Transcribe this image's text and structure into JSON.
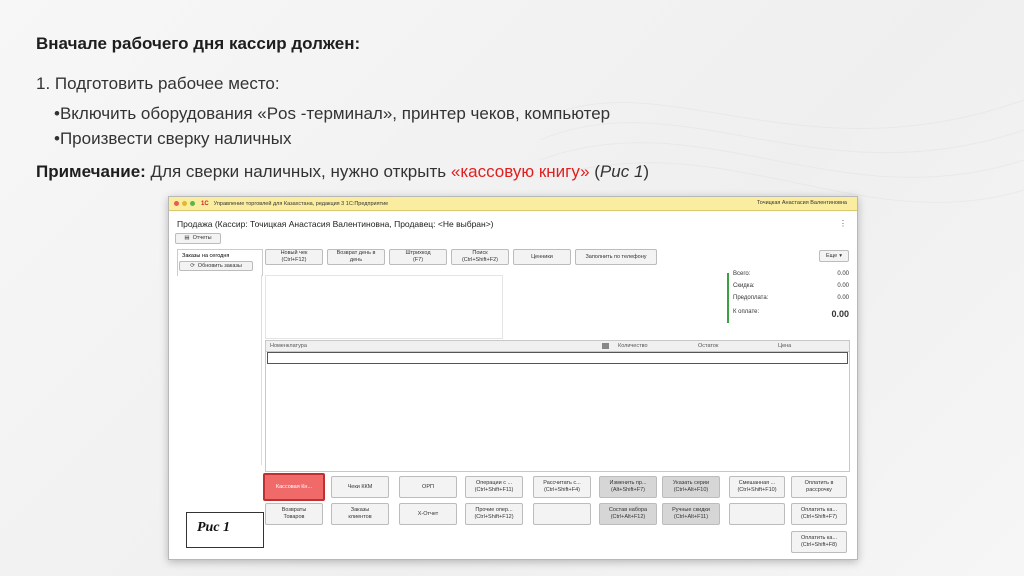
{
  "slide": {
    "title": "Вначале рабочего дня кассир должен:",
    "step1": "1. Подготовить рабочее место:",
    "bullets": [
      "Включить оборудования «Pos -терминал», принтер чеков, компьютер",
      "Произвести сверку наличных"
    ],
    "note_label": "Примечание:",
    "note_text": " Для сверки наличных, нужно открыть ",
    "note_link": "«кассовую книгу»",
    "note_open_paren": " (",
    "note_ref": "Рис 1",
    "note_close_paren": ")"
  },
  "window": {
    "app_title": "Управление торговлей для Казахстана, редакция 3 1С:Предприятие",
    "logo": "1С",
    "user": "Точицкая Анастасия Валентиновна",
    "doc_title": "Продажа (Кассир: Точицкая Анастасия Валентиновна, Продавец: <Не выбран>)",
    "reports_button": "Отчеты",
    "more_button": "Еще",
    "toolbar": [
      {
        "line1": "Новый чек",
        "line2": "(Ctrl+F12)"
      },
      {
        "line1": "Возврат день в",
        "line2": "день"
      },
      {
        "line1": "Штрихкод",
        "line2": "(F7)"
      },
      {
        "line1": "Поиск",
        "line2": "(Ctrl+Shift+F2)"
      },
      {
        "line1": "Ценники",
        "line2": ""
      },
      {
        "line1": "Заполнить по телефону",
        "line2": ""
      }
    ],
    "left_tab": "Заказы на сегодня",
    "refresh_orders": "Обновить заказы",
    "totals": [
      {
        "label": "Всего:",
        "value": "0.00"
      },
      {
        "label": "Скидка:",
        "value": "0.00"
      },
      {
        "label": "Предоплата:",
        "value": "0.00"
      },
      {
        "label": "К оплате:",
        "value": "0.00"
      }
    ],
    "table_headers": [
      "Номенклатура",
      "Количество",
      "Остаток",
      "Цена"
    ],
    "bottom_buttons_row1": [
      {
        "line1": "Кассовая Кн...",
        "line2": ""
      },
      {
        "line1": "Чеки ККМ",
        "line2": ""
      },
      {
        "line1": "ОРП",
        "line2": ""
      },
      {
        "line1": "Операции с ...",
        "line2": "(Ctrl+Shift+F11)"
      },
      {
        "line1": "Рассчитать с...",
        "line2": "(Ctrl+Shift+F4)"
      },
      {
        "line1": "Изменить пр...",
        "line2": "(Alt+Shift+F7)"
      },
      {
        "line1": "Указать серии",
        "line2": "(Ctrl+Alt+F10)"
      },
      {
        "line1": "Смешанная ...",
        "line2": "(Ctrl+Shift+F10)"
      },
      {
        "line1": "Оплатить в",
        "line2": "рассрочку"
      }
    ],
    "bottom_buttons_row2": [
      {
        "line1": "Возвраты",
        "line2": "Товаров"
      },
      {
        "line1": "Заказы",
        "line2": "клиентов"
      },
      {
        "line1": "X-Отчет",
        "line2": ""
      },
      {
        "line1": "Прочие опер...",
        "line2": "(Ctrl+Shift+F12)"
      },
      {
        "line1": "",
        "line2": ""
      },
      {
        "line1": "Состав набора",
        "line2": "(Ctrl+Alt+F12)"
      },
      {
        "line1": "Ручные скидки",
        "line2": "(Ctrl+Alt+F11)"
      },
      {
        "line1": "",
        "line2": ""
      },
      {
        "line1": "Оплатить ка...",
        "line2": "(Ctrl+Shift+F7)"
      }
    ],
    "bottom_button_row3": {
      "line1": "Оплатить ка...",
      "line2": "(Ctrl+Shift+F8)"
    }
  },
  "figure_label": "Рис 1",
  "colors": {
    "accent_red": "#e02020",
    "highlight_button": "#f06a6a",
    "titlebar": "#fbeda0"
  }
}
